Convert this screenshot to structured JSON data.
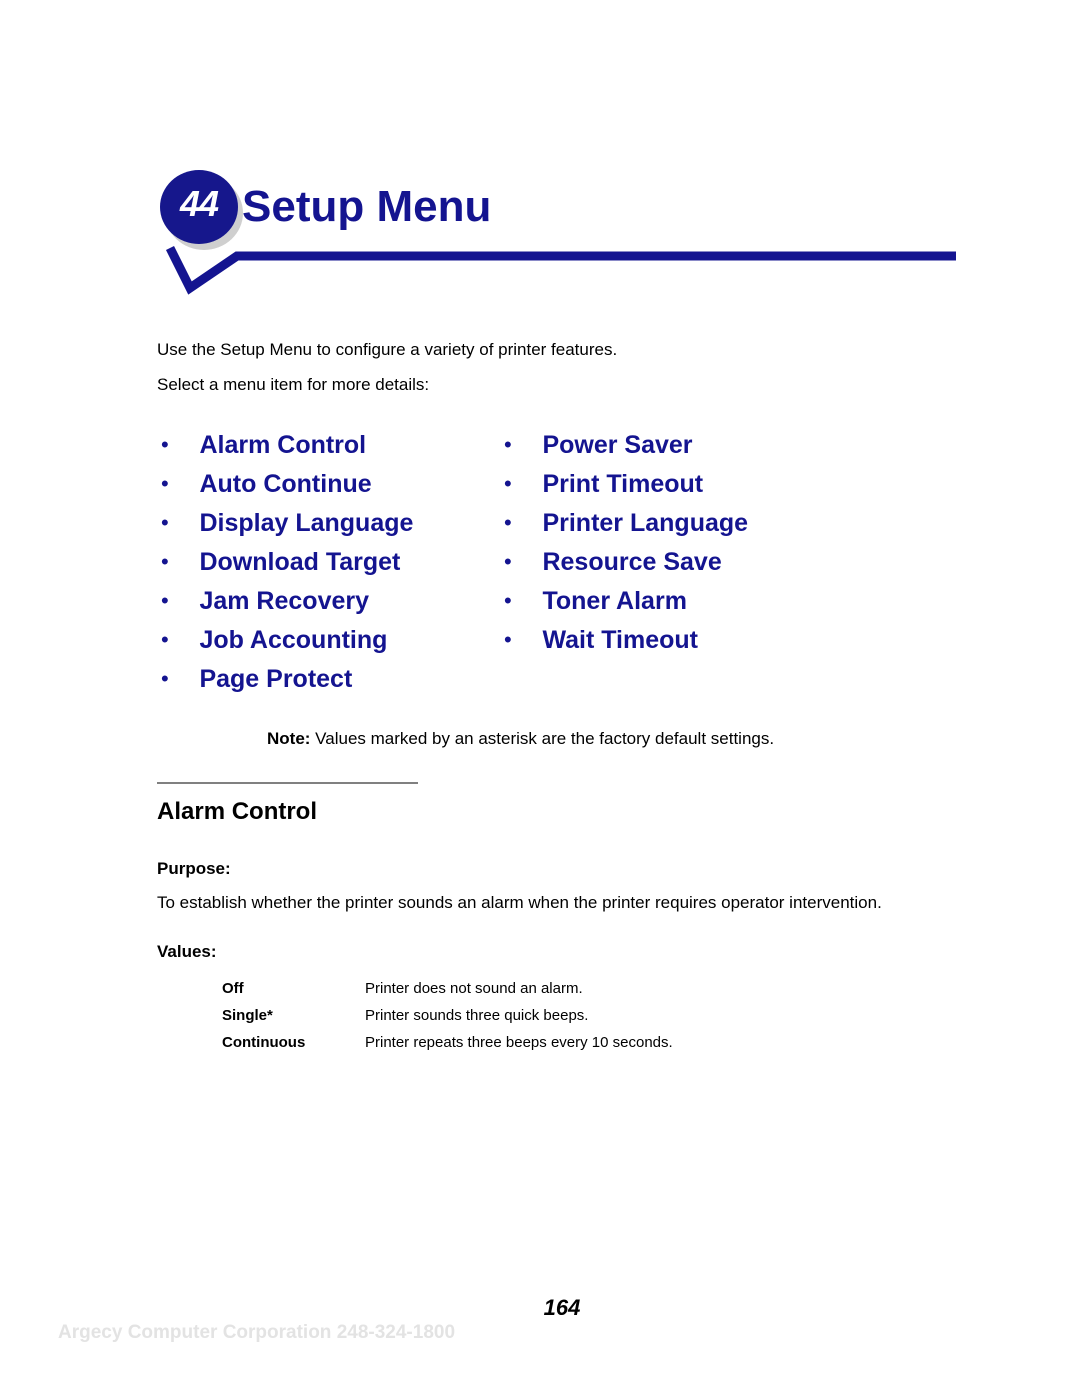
{
  "header": {
    "chapter_number": "44",
    "title": "Setup Menu",
    "badge_color": "#16178c",
    "title_color": "#141490",
    "rule_color": "#141490"
  },
  "intro": {
    "line1": "Use the Setup Menu to configure a variety of printer features.",
    "line2": "Select a menu item for more details:"
  },
  "menu_links": {
    "bullet_glyph": "•",
    "link_color": "#141490",
    "left_column": [
      {
        "label": "Alarm Control"
      },
      {
        "label": "Auto Continue"
      },
      {
        "label": "Display Language"
      },
      {
        "label": "Download Target"
      },
      {
        "label": "Jam Recovery"
      },
      {
        "label": "Job Accounting"
      },
      {
        "label": "Page Protect"
      }
    ],
    "right_column": [
      {
        "label": "Power Saver"
      },
      {
        "label": "Print Timeout"
      },
      {
        "label": "Printer Language"
      },
      {
        "label": "Resource Save"
      },
      {
        "label": "Toner Alarm"
      },
      {
        "label": "Wait Timeout"
      }
    ]
  },
  "note": {
    "label": "Note:",
    "text": " Values marked by an asterisk are the factory default settings."
  },
  "section": {
    "heading": "Alarm Control",
    "purpose_label": "Purpose:",
    "purpose_text": "To establish whether the printer sounds an alarm when the printer requires operator intervention.",
    "values_label": "Values:",
    "values_rows": [
      {
        "name": "Off",
        "description": "Printer does not sound an alarm."
      },
      {
        "name": "Single*",
        "description": "Printer sounds three quick beeps."
      },
      {
        "name": "Continuous",
        "description": "Printer repeats three beeps every 10 seconds."
      }
    ]
  },
  "footer": {
    "page_number": "164",
    "watermark": "Argecy Computer Corporation 248-324-1800"
  }
}
